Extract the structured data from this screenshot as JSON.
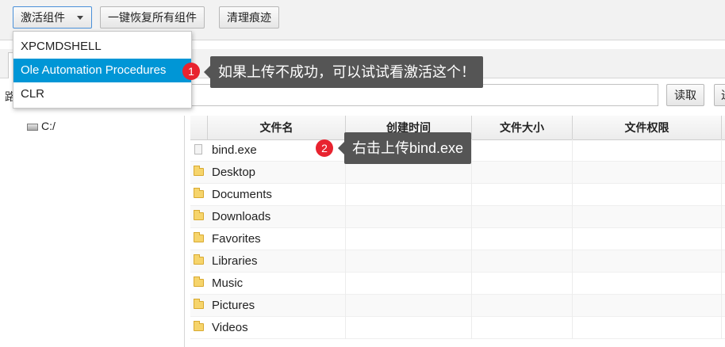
{
  "toolbar": {
    "activate_label": "激活组件",
    "restore_label": "一键恢复所有组件",
    "clean_label": "清理痕迹"
  },
  "dropdown": {
    "items": [
      {
        "label": "XPCMDSHELL",
        "selected": false
      },
      {
        "label": "Ole Automation Procedures",
        "selected": true
      },
      {
        "label": "CLR",
        "selected": false
      }
    ]
  },
  "path_bar": {
    "label": "路",
    "value": "",
    "read_label": "读取",
    "edge_label": "进"
  },
  "tree": {
    "items": [
      {
        "label": "C:/",
        "icon": "drive-icon"
      }
    ]
  },
  "table": {
    "headers": [
      "文件名",
      "创建时间",
      "文件大小",
      "文件权限"
    ],
    "rows": [
      {
        "name": "bind.exe",
        "icon": "file-icon"
      },
      {
        "name": "Desktop",
        "icon": "folder-icon"
      },
      {
        "name": "Documents",
        "icon": "folder-icon"
      },
      {
        "name": "Downloads",
        "icon": "folder-icon"
      },
      {
        "name": "Favorites",
        "icon": "folder-icon"
      },
      {
        "name": "Libraries",
        "icon": "folder-icon"
      },
      {
        "name": "Music",
        "icon": "folder-icon"
      },
      {
        "name": "Pictures",
        "icon": "folder-icon"
      },
      {
        "name": "Videos",
        "icon": "folder-icon"
      }
    ]
  },
  "annotations": [
    {
      "number": "1",
      "text": "如果上传不成功，可以试试看激活这个！"
    },
    {
      "number": "2",
      "text": "右击上传bind.exe"
    }
  ],
  "colors": {
    "selection": "#0096d6",
    "badge": "#e8232f",
    "callout": "#555555"
  }
}
